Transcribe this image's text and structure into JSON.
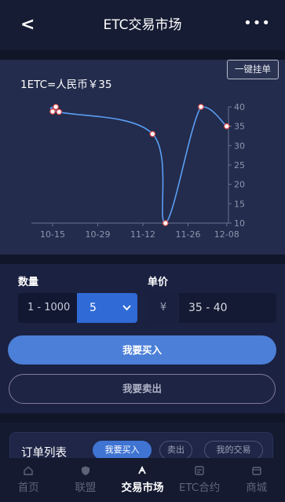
{
  "header": {
    "back_label": "<",
    "title": "ETC交易市场",
    "more_label": "•••"
  },
  "chart_card": {
    "pending_order_label": "一键挂单",
    "price_label": "1ETC=人民币￥35"
  },
  "chart_data": {
    "type": "line",
    "title": "",
    "xlabel": "",
    "ylabel": "",
    "x_tick_labels": [
      "10-15",
      "10-29",
      "11-12",
      "11-26",
      "12-08"
    ],
    "y_tick_labels": [
      "10",
      "15",
      "20",
      "25",
      "30",
      "35",
      "40"
    ],
    "ylim": [
      10,
      40
    ],
    "grid": false,
    "series": [
      {
        "x": [
          "10-15",
          "10-16",
          "10-17",
          "11-15",
          "11-19",
          "11-30",
          "12-08"
        ],
        "values": [
          38.8,
          40,
          38.7,
          33,
          10,
          40,
          35
        ]
      }
    ],
    "colors": {
      "line": "#5b9ef5",
      "marker_fill": "#ffffff",
      "marker_stroke": "#e04a4a"
    }
  },
  "trade": {
    "quantity_label": "数量",
    "quantity_range": "1 - 1000",
    "quantity_value": "5",
    "unit_price_label": "单价",
    "currency_symbol": "¥",
    "price_range": "35 - 40",
    "buy_label": "我要买入",
    "sell_label": "我要卖出"
  },
  "orders": {
    "title": "订单列表",
    "tabs": [
      "我要买入",
      "卖出",
      "我的交易"
    ]
  },
  "tabbar": {
    "items": [
      {
        "label": "首页",
        "icon": "home-icon"
      },
      {
        "label": "联盟",
        "icon": "shield-icon"
      },
      {
        "label": "交易市场",
        "icon": "market-icon",
        "active": true
      },
      {
        "label": "ETC合约",
        "icon": "contract-icon"
      },
      {
        "label": "商城",
        "icon": "shop-icon"
      }
    ]
  },
  "colors": {
    "accent": "#3f74d2",
    "background": "#141a30",
    "card": "#232c4c"
  }
}
